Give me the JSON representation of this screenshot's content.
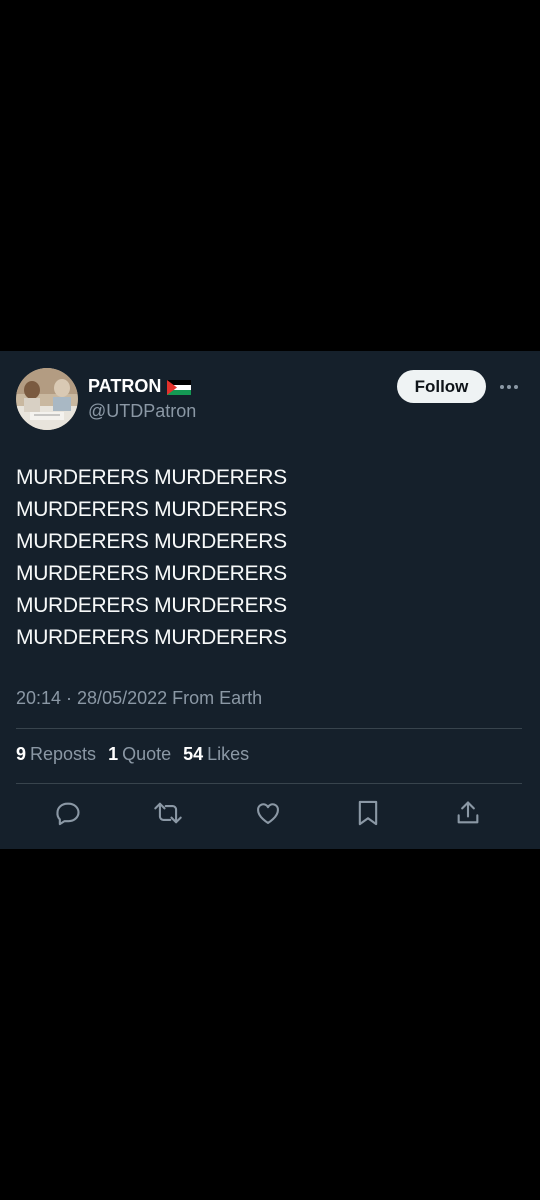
{
  "author": {
    "name": "PATRON",
    "handle": "@UTDPatron",
    "flag_icon": "palestine-flag-icon",
    "avatar_icon": "avatar-photo"
  },
  "follow_label": "Follow",
  "more_icon": "more-options-icon",
  "tweet": {
    "lines": [
      "MURDERERS MURDERERS",
      "MURDERERS MURDERERS",
      "MURDERERS MURDERERS",
      "MURDERERS MURDERERS",
      "MURDERERS MURDERERS",
      "MURDERERS MURDERERS"
    ],
    "meta": "20:14 · 28/05/2022 From Earth"
  },
  "stats": {
    "reposts_count": "9",
    "reposts_label": "Reposts",
    "quotes_count": "1",
    "quotes_label": "Quote",
    "likes_count": "54",
    "likes_label": "Likes"
  },
  "actions": [
    "reply-icon",
    "repost-icon",
    "like-icon",
    "bookmark-icon",
    "share-icon"
  ],
  "colors": {
    "card_background": "#15202b",
    "page_background": "#000000",
    "secondary_text": "#8b98a5",
    "divider": "#38444d",
    "follow_button": "#eff3f4"
  }
}
